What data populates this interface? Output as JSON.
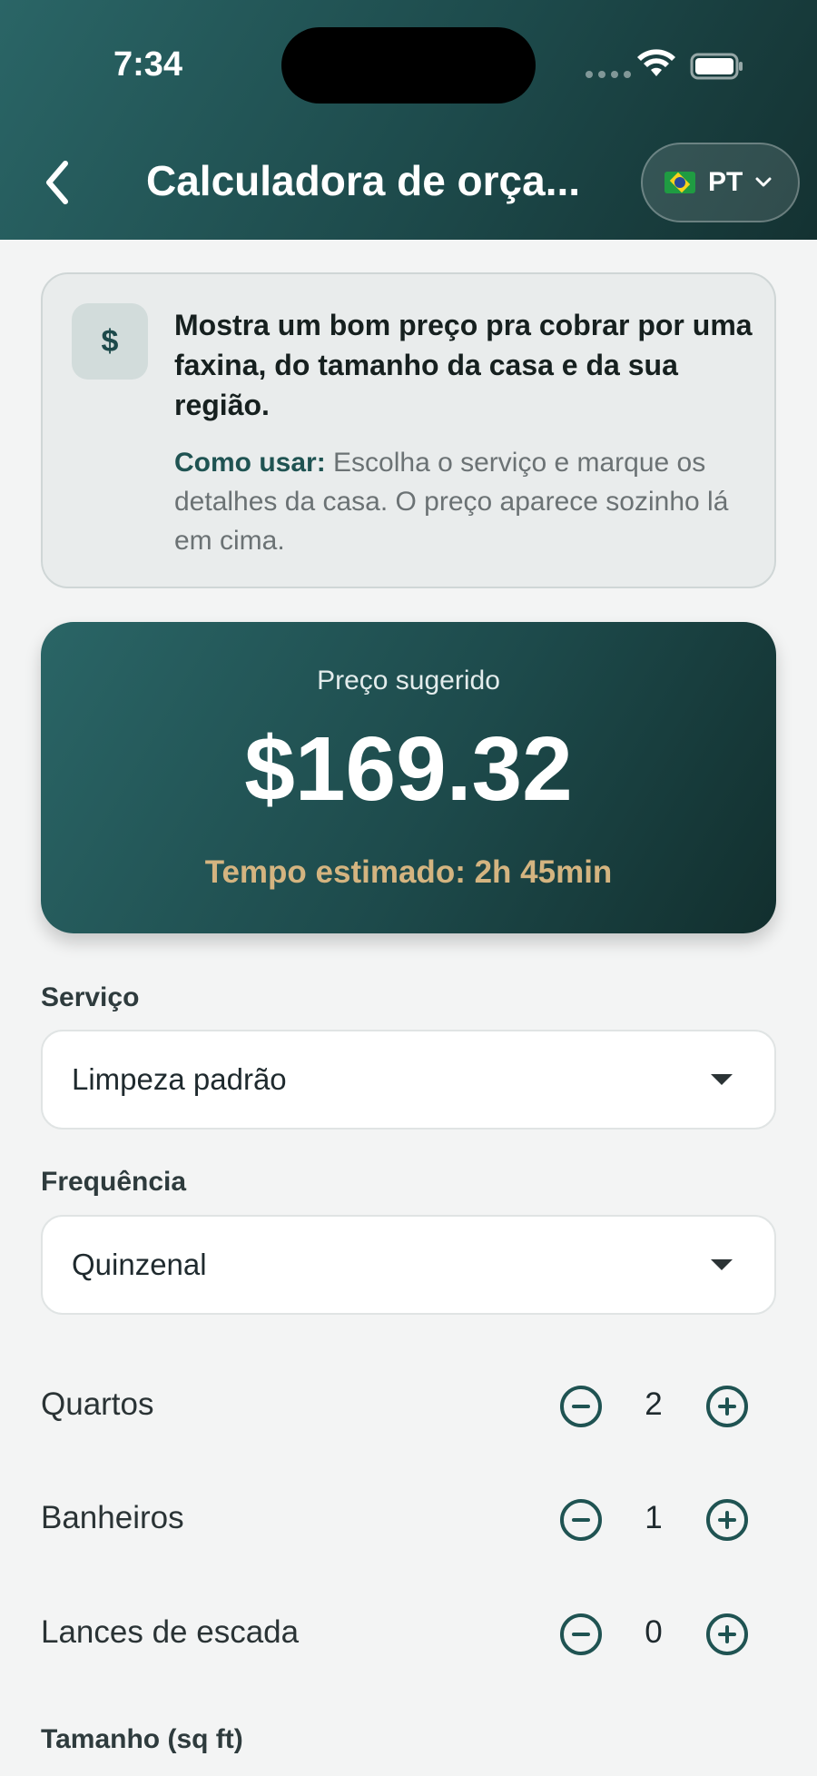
{
  "status_bar": {
    "time": "7:34"
  },
  "header": {
    "title": "Calculadora de orça...",
    "language": "PT"
  },
  "info": {
    "icon_symbol": "$",
    "description": "Mostra um bom preço pra cobrar por uma faxina, do tamanho da casa e da sua região.",
    "how_to_label": "Como usar:",
    "how_to_text": " Escolha o serviço e marque os detalhes da casa. O preço aparece sozinho lá em cima."
  },
  "price_card": {
    "label": "Preço sugerido",
    "value": "$169.32",
    "estimated_time": "Tempo estimado: 2h 45min"
  },
  "service": {
    "label": "Serviço",
    "value": "Limpeza padrão"
  },
  "frequency": {
    "label": "Frequência",
    "value": "Quinzenal"
  },
  "steppers": [
    {
      "label": "Quartos",
      "value": "2"
    },
    {
      "label": "Banheiros",
      "value": "1"
    },
    {
      "label": "Lances de escada",
      "value": "0"
    }
  ],
  "size": {
    "label": "Tamanho (sq ft)"
  },
  "colors": {
    "accent": "#1f5352",
    "header": "#1d4a4b",
    "highlight": "#d4b480"
  }
}
